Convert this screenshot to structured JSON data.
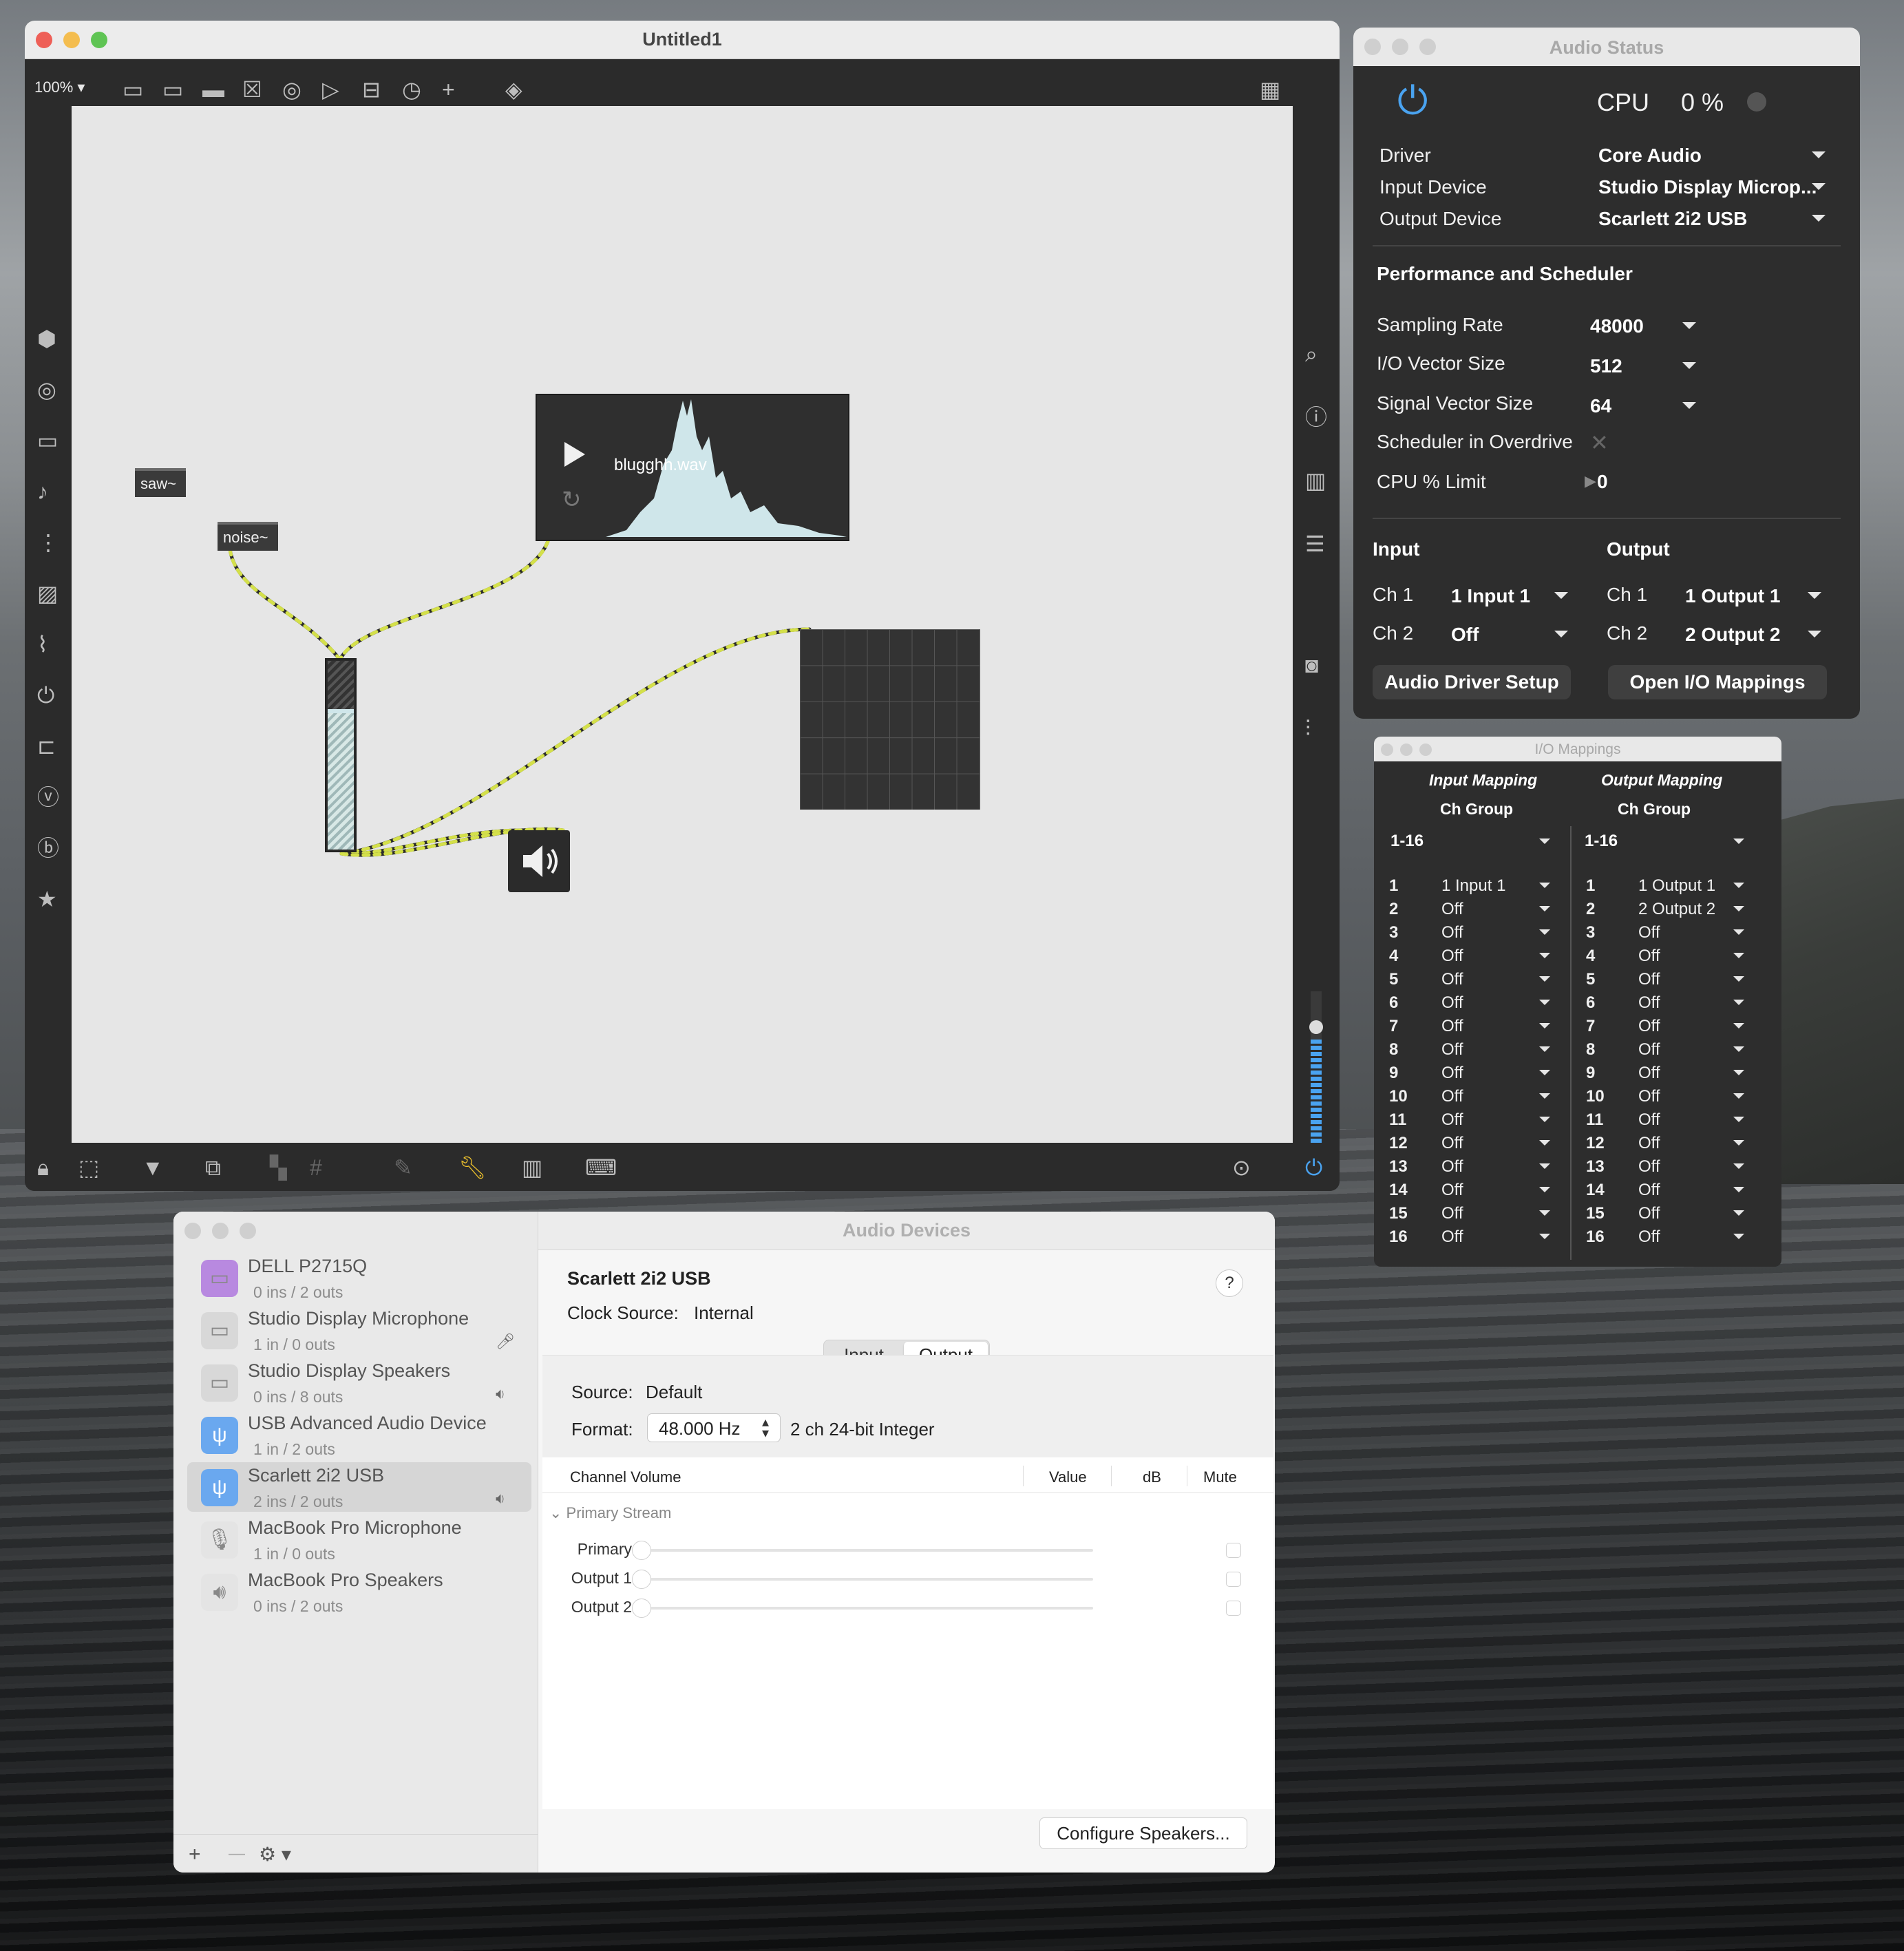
{
  "max_window": {
    "title": "Untitled1",
    "zoom": "100%",
    "objects": {
      "saw": "saw~",
      "noise": "noise~",
      "playlist_file": "blugghh.wav"
    }
  },
  "audio_status": {
    "title": "Audio Status",
    "cpu_label": "CPU",
    "cpu_value": "0 %",
    "driver_label": "Driver",
    "driver_value": "Core Audio",
    "input_device_label": "Input Device",
    "input_device_value": "Studio Display Microp...",
    "output_device_label": "Output Device",
    "output_device_value": "Scarlett 2i2 USB",
    "perf_heading": "Performance and Scheduler",
    "sampling_rate_label": "Sampling Rate",
    "sampling_rate_value": "48000",
    "io_vector_label": "I/O Vector Size",
    "io_vector_value": "512",
    "signal_vector_label": "Signal Vector Size",
    "signal_vector_value": "64",
    "overdrive_label": "Scheduler in Overdrive",
    "cpu_limit_label": "CPU % Limit",
    "cpu_limit_value": "0",
    "input_heading": "Input",
    "output_heading": "Output",
    "in_ch1_label": "Ch 1",
    "in_ch1_value": "1 Input 1",
    "in_ch2_label": "Ch 2",
    "in_ch2_value": "Off",
    "out_ch1_label": "Ch 1",
    "out_ch1_value": "1 Output 1",
    "out_ch2_label": "Ch 2",
    "out_ch2_value": "2 Output 2",
    "driver_setup_button": "Audio Driver Setup",
    "open_mappings_button": "Open I/O Mappings"
  },
  "io_mappings": {
    "title": "I/O Mappings",
    "input_heading": "Input Mapping",
    "output_heading": "Output Mapping",
    "ch_group_label": "Ch Group",
    "input_group": "1-16",
    "output_group": "1-16",
    "input_rows": [
      {
        "n": "1",
        "v": "1 Input 1"
      },
      {
        "n": "2",
        "v": "Off"
      },
      {
        "n": "3",
        "v": "Off"
      },
      {
        "n": "4",
        "v": "Off"
      },
      {
        "n": "5",
        "v": "Off"
      },
      {
        "n": "6",
        "v": "Off"
      },
      {
        "n": "7",
        "v": "Off"
      },
      {
        "n": "8",
        "v": "Off"
      },
      {
        "n": "9",
        "v": "Off"
      },
      {
        "n": "10",
        "v": "Off"
      },
      {
        "n": "11",
        "v": "Off"
      },
      {
        "n": "12",
        "v": "Off"
      },
      {
        "n": "13",
        "v": "Off"
      },
      {
        "n": "14",
        "v": "Off"
      },
      {
        "n": "15",
        "v": "Off"
      },
      {
        "n": "16",
        "v": "Off"
      }
    ],
    "output_rows": [
      {
        "n": "1",
        "v": "1 Output 1"
      },
      {
        "n": "2",
        "v": "2 Output 2"
      },
      {
        "n": "3",
        "v": "Off"
      },
      {
        "n": "4",
        "v": "Off"
      },
      {
        "n": "5",
        "v": "Off"
      },
      {
        "n": "6",
        "v": "Off"
      },
      {
        "n": "7",
        "v": "Off"
      },
      {
        "n": "8",
        "v": "Off"
      },
      {
        "n": "9",
        "v": "Off"
      },
      {
        "n": "10",
        "v": "Off"
      },
      {
        "n": "11",
        "v": "Off"
      },
      {
        "n": "12",
        "v": "Off"
      },
      {
        "n": "13",
        "v": "Off"
      },
      {
        "n": "14",
        "v": "Off"
      },
      {
        "n": "15",
        "v": "Off"
      },
      {
        "n": "16",
        "v": "Off"
      }
    ]
  },
  "audio_devices": {
    "title": "Audio Devices",
    "devices": [
      {
        "name": "DELL P2715Q",
        "sub": "0 ins / 2 outs"
      },
      {
        "name": "Studio Display Microphone",
        "sub": "1 in / 0 outs"
      },
      {
        "name": "Studio Display Speakers",
        "sub": "0 ins / 8 outs"
      },
      {
        "name": "USB Advanced Audio Device",
        "sub": "1 in / 2 outs"
      },
      {
        "name": "Scarlett 2i2 USB",
        "sub": "2 ins / 2 outs"
      },
      {
        "name": "MacBook Pro Microphone",
        "sub": "1 in / 0 outs"
      },
      {
        "name": "MacBook Pro Speakers",
        "sub": "0 ins / 2 outs"
      }
    ],
    "selected_name": "Scarlett 2i2 USB",
    "clock_label": "Clock Source:",
    "clock_value": "Internal",
    "help": "?",
    "tab_input": "Input",
    "tab_output": "Output",
    "source_label": "Source:",
    "source_value": "Default",
    "format_label": "Format:",
    "format_rate": "48.000 Hz",
    "format_detail": "2 ch 24-bit Integer",
    "col_channel_volume": "Channel Volume",
    "col_value": "Value",
    "col_db": "dB",
    "col_mute": "Mute",
    "stream_label": "Primary Stream",
    "channels": [
      "Primary",
      "Output 1",
      "Output 2"
    ],
    "configure_button": "Configure Speakers...",
    "add": "+",
    "remove": "—"
  },
  "colors": {
    "accent_blue": "#4aa3f0",
    "max_dark": "#2c2c2c",
    "patch_bg": "#e6e6e6"
  }
}
